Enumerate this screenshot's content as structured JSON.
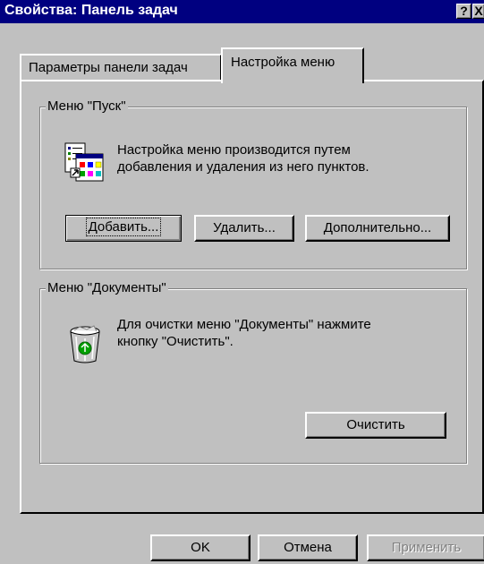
{
  "window": {
    "title": "Свойства: Панель задач",
    "help_label": "?",
    "close_label": "X"
  },
  "tabs": [
    {
      "label": "Параметры панели задач",
      "active": false
    },
    {
      "label": "Настройка меню",
      "active": true
    }
  ],
  "start_menu": {
    "legend": "Меню \"Пуск\"",
    "description_line1": "Настройка меню производится путем",
    "description_line2": "добавления и удаления из него пунктов.",
    "icon": "start-menu-settings-icon",
    "buttons": {
      "add": "Добавить...",
      "remove": "Удалить...",
      "advanced": "Дополнительно..."
    }
  },
  "documents_menu": {
    "legend": "Меню \"Документы\"",
    "description_line1": "Для очистки меню \"Документы\" нажмите",
    "description_line2": "кнопку \"Очистить\".",
    "icon": "recycle-bin-icon",
    "buttons": {
      "clear": "Очистить"
    }
  },
  "dialog_buttons": {
    "ok": "OK",
    "cancel": "Отмена",
    "apply": "Применить"
  },
  "colors": {
    "titlebar": "#000080",
    "face": "#c0c0c0",
    "disabled_text": "#808080"
  }
}
